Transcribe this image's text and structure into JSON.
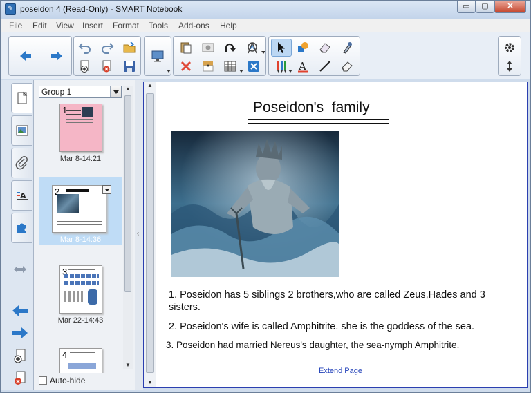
{
  "window": {
    "title": "poseidon 4 (Read-Only) - SMART Notebook",
    "controls": {
      "minimize": "▭",
      "maximize": "▢",
      "close": "✕"
    }
  },
  "menu": [
    "File",
    "Edit",
    "View",
    "Insert",
    "Format",
    "Tools",
    "Add-ons",
    "Help"
  ],
  "toolbar": {
    "left_group": [
      "previous-page-icon",
      "next-page-icon"
    ],
    "edit_group": [
      "undo-icon",
      "redo-icon",
      "open-folder-icon",
      "add-page-icon",
      "delete-page-icon",
      "save-icon"
    ],
    "display_group": [
      "screen-shade-display-icon"
    ],
    "object_group": [
      "paste-icon",
      "screen-capture-icon",
      "redo-arrow-icon",
      "math-tools-icon",
      "delete-icon",
      "screen-shade-icon",
      "table-icon",
      "fullscreen-toggle-icon"
    ],
    "tools_group": [
      "select-icon",
      "shapes-icon",
      "eraser-icon",
      "magic-pen-icon",
      "pens-icon",
      "text-icon",
      "line-icon",
      "creative-eraser-icon"
    ],
    "right_group": [
      "settings-gear-icon",
      "move-toolbar-icon"
    ]
  },
  "sidetabs": [
    "page-sorter-icon",
    "gallery-icon",
    "attachments-icon",
    "properties-icon",
    "add-ons-icon"
  ],
  "sorter": {
    "group_label": "Group 1",
    "pages": [
      {
        "number": "1",
        "date": "Mar 8-14:21"
      },
      {
        "number": "2",
        "date": "Mar 8-14:36"
      },
      {
        "number": "3",
        "date": "Mar 22-14:43"
      },
      {
        "number": "4",
        "date": ""
      }
    ],
    "autohide_label": "Auto-hide"
  },
  "page": {
    "title": "Poseidon's  family",
    "facts": [
      "1. Poseidon has 5 siblings 2 brothers,who are called Zeus,Hades and 3 sisters.",
      "2. Poseidon's wife is called Amphitrite. she is the goddess of the sea.",
      "3. Poseidon had married Nereus's daughter, the sea-nymph Amphitrite."
    ],
    "extend_link": "Extend Page"
  },
  "colors": {
    "accent_blue": "#2b78c8",
    "selection": "#bfdcf6",
    "link": "#1f3fb8",
    "canvas_border": "#2b3fb0"
  }
}
